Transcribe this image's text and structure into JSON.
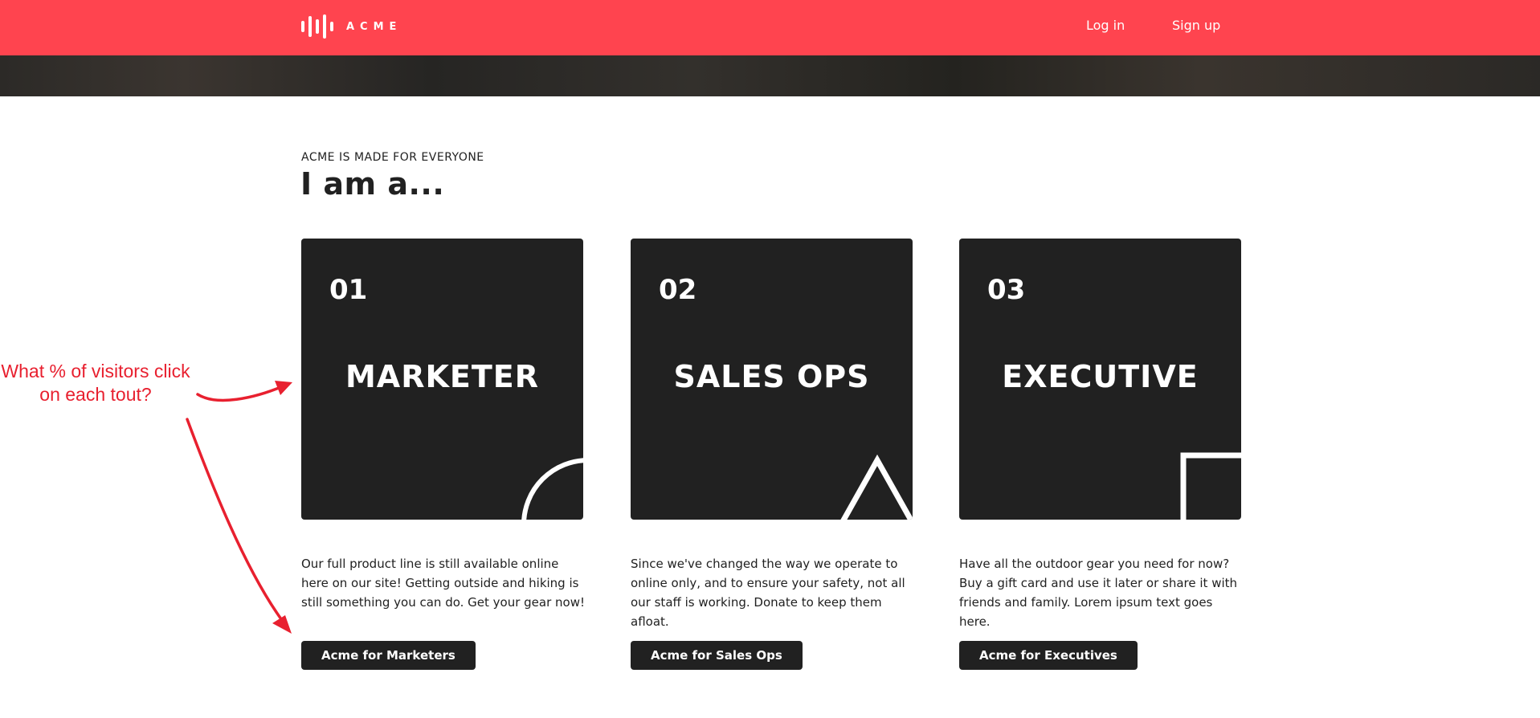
{
  "header": {
    "logo_text": "ACME",
    "nav": {
      "login_label": "Log in",
      "signup_label": "Sign up"
    },
    "background_color": "#ff444f"
  },
  "section": {
    "eyebrow": "ACME IS MADE FOR EVERYONE",
    "headline": "I am a...",
    "tiles": [
      {
        "number": "01",
        "title": "MARKETER",
        "shape_icon": "half-circle-icon",
        "description": "Our full product line is still available online here on our site! Getting outside and hiking is still something you can do. Get your gear now!",
        "button_label": "Acme for Marketers"
      },
      {
        "number": "02",
        "title": "SALES OPS",
        "shape_icon": "triangle-icon",
        "description": "Since we've changed the way we operate to online only, and to ensure your safety, not all our staff is working. Donate to keep them afloat.",
        "button_label": "Acme for Sales Ops"
      },
      {
        "number": "03",
        "title": "EXECUTIVE",
        "shape_icon": "square-icon",
        "description": "Have all the outdoor gear you need for now? Buy a gift card and use it later or share it with friends and family. Lorem ipsum text goes here.",
        "button_label": "Acme for Executives"
      }
    ]
  },
  "annotation": {
    "text": "What % of visitors click on each tout?",
    "color": "#e8202f"
  },
  "colors": {
    "accent": "#ff444f",
    "tile_bg": "#212121",
    "text": "#212121"
  }
}
